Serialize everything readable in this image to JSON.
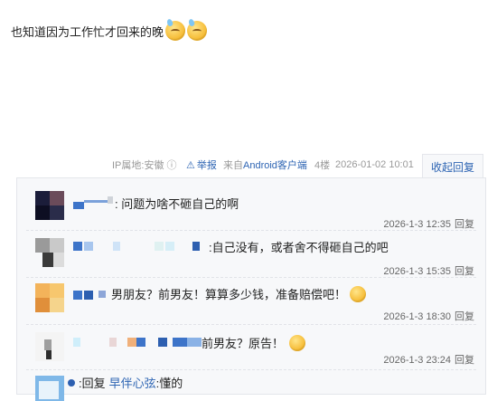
{
  "post": {
    "text": "也知道因为工作忙才回来的晚",
    "emojis": [
      "sweat-smile-emoji",
      "sweat-smile-emoji"
    ]
  },
  "meta": {
    "ip": "IP属地:安徽 ⓘ",
    "report": "举报",
    "source_prefix": "来自",
    "source_client": "Android客户端",
    "floor": "4楼",
    "date": "2026-01-02 10:01",
    "collapse": "收起回复"
  },
  "replies": [
    {
      "content": ": 问题为啥不砸自己的啊",
      "time": "2026-1-3 12:35",
      "reply": "回复"
    },
    {
      "content": ":自己没有，或者舍不得砸自己的吧",
      "time": "2026-1-3 15:35",
      "reply": "回复"
    },
    {
      "content": "男朋友？前男友！算算多少钱，准备赔偿吧！",
      "time": "2026-1-3 18:30",
      "reply": "回复"
    },
    {
      "content": "前男友？原告！",
      "time": "2026-1-3 23:24",
      "reply": "回复"
    }
  ],
  "partial_reply": {
    "prefix": ":回复",
    "link": "早伴心弦",
    "suffix": ":懂的"
  },
  "colors": {
    "link": "#2d64b3",
    "panel_bg": "#f7f8fa",
    "border": "#e4e6eb"
  }
}
